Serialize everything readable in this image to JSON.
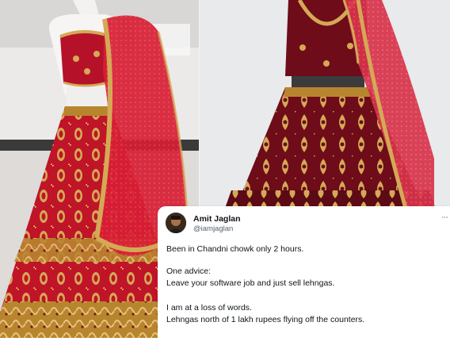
{
  "tweet": {
    "author_name": "Amit Jaglan",
    "author_handle": "@iamjaglan",
    "more_icon": "ellipsis-icon",
    "line_1": "Been in Chandni chowk only 2 hours.",
    "line_2": "One advice:",
    "line_3": "Leave your software job and just sell lehngas.",
    "line_4": "I am at a loss of words.",
    "line_5": "Lehngas north of 1 lakh rupees flying off the counters."
  },
  "colors": {
    "lehenga_red": "#c01428",
    "lehenga_maroon": "#6e0c1a",
    "gold_embroidery": "#d4a955",
    "dupatta_red": "#d81e34",
    "text_primary": "#0f1419",
    "text_secondary": "#536471"
  }
}
